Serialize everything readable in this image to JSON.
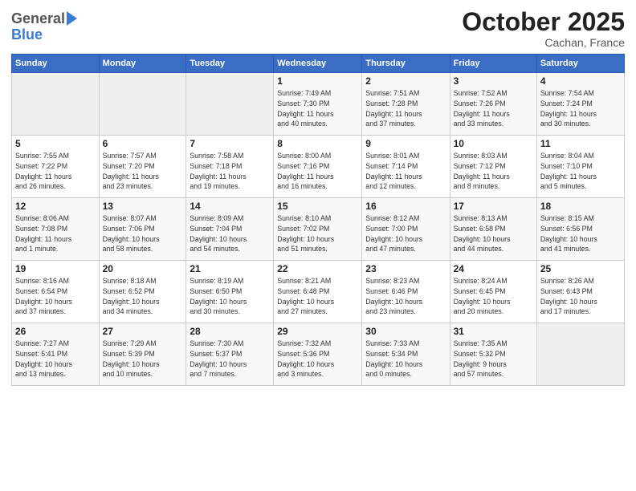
{
  "logo": {
    "general": "General",
    "blue": "Blue"
  },
  "header": {
    "month": "October 2025",
    "location": "Cachan, France"
  },
  "weekdays": [
    "Sunday",
    "Monday",
    "Tuesday",
    "Wednesday",
    "Thursday",
    "Friday",
    "Saturday"
  ],
  "weeks": [
    [
      {
        "day": "",
        "info": ""
      },
      {
        "day": "",
        "info": ""
      },
      {
        "day": "",
        "info": ""
      },
      {
        "day": "1",
        "info": "Sunrise: 7:49 AM\nSunset: 7:30 PM\nDaylight: 11 hours\nand 40 minutes."
      },
      {
        "day": "2",
        "info": "Sunrise: 7:51 AM\nSunset: 7:28 PM\nDaylight: 11 hours\nand 37 minutes."
      },
      {
        "day": "3",
        "info": "Sunrise: 7:52 AM\nSunset: 7:26 PM\nDaylight: 11 hours\nand 33 minutes."
      },
      {
        "day": "4",
        "info": "Sunrise: 7:54 AM\nSunset: 7:24 PM\nDaylight: 11 hours\nand 30 minutes."
      }
    ],
    [
      {
        "day": "5",
        "info": "Sunrise: 7:55 AM\nSunset: 7:22 PM\nDaylight: 11 hours\nand 26 minutes."
      },
      {
        "day": "6",
        "info": "Sunrise: 7:57 AM\nSunset: 7:20 PM\nDaylight: 11 hours\nand 23 minutes."
      },
      {
        "day": "7",
        "info": "Sunrise: 7:58 AM\nSunset: 7:18 PM\nDaylight: 11 hours\nand 19 minutes."
      },
      {
        "day": "8",
        "info": "Sunrise: 8:00 AM\nSunset: 7:16 PM\nDaylight: 11 hours\nand 16 minutes."
      },
      {
        "day": "9",
        "info": "Sunrise: 8:01 AM\nSunset: 7:14 PM\nDaylight: 11 hours\nand 12 minutes."
      },
      {
        "day": "10",
        "info": "Sunrise: 8:03 AM\nSunset: 7:12 PM\nDaylight: 11 hours\nand 8 minutes."
      },
      {
        "day": "11",
        "info": "Sunrise: 8:04 AM\nSunset: 7:10 PM\nDaylight: 11 hours\nand 5 minutes."
      }
    ],
    [
      {
        "day": "12",
        "info": "Sunrise: 8:06 AM\nSunset: 7:08 PM\nDaylight: 11 hours\nand 1 minute."
      },
      {
        "day": "13",
        "info": "Sunrise: 8:07 AM\nSunset: 7:06 PM\nDaylight: 10 hours\nand 58 minutes."
      },
      {
        "day": "14",
        "info": "Sunrise: 8:09 AM\nSunset: 7:04 PM\nDaylight: 10 hours\nand 54 minutes."
      },
      {
        "day": "15",
        "info": "Sunrise: 8:10 AM\nSunset: 7:02 PM\nDaylight: 10 hours\nand 51 minutes."
      },
      {
        "day": "16",
        "info": "Sunrise: 8:12 AM\nSunset: 7:00 PM\nDaylight: 10 hours\nand 47 minutes."
      },
      {
        "day": "17",
        "info": "Sunrise: 8:13 AM\nSunset: 6:58 PM\nDaylight: 10 hours\nand 44 minutes."
      },
      {
        "day": "18",
        "info": "Sunrise: 8:15 AM\nSunset: 6:56 PM\nDaylight: 10 hours\nand 41 minutes."
      }
    ],
    [
      {
        "day": "19",
        "info": "Sunrise: 8:16 AM\nSunset: 6:54 PM\nDaylight: 10 hours\nand 37 minutes."
      },
      {
        "day": "20",
        "info": "Sunrise: 8:18 AM\nSunset: 6:52 PM\nDaylight: 10 hours\nand 34 minutes."
      },
      {
        "day": "21",
        "info": "Sunrise: 8:19 AM\nSunset: 6:50 PM\nDaylight: 10 hours\nand 30 minutes."
      },
      {
        "day": "22",
        "info": "Sunrise: 8:21 AM\nSunset: 6:48 PM\nDaylight: 10 hours\nand 27 minutes."
      },
      {
        "day": "23",
        "info": "Sunrise: 8:23 AM\nSunset: 6:46 PM\nDaylight: 10 hours\nand 23 minutes."
      },
      {
        "day": "24",
        "info": "Sunrise: 8:24 AM\nSunset: 6:45 PM\nDaylight: 10 hours\nand 20 minutes."
      },
      {
        "day": "25",
        "info": "Sunrise: 8:26 AM\nSunset: 6:43 PM\nDaylight: 10 hours\nand 17 minutes."
      }
    ],
    [
      {
        "day": "26",
        "info": "Sunrise: 7:27 AM\nSunset: 5:41 PM\nDaylight: 10 hours\nand 13 minutes."
      },
      {
        "day": "27",
        "info": "Sunrise: 7:29 AM\nSunset: 5:39 PM\nDaylight: 10 hours\nand 10 minutes."
      },
      {
        "day": "28",
        "info": "Sunrise: 7:30 AM\nSunset: 5:37 PM\nDaylight: 10 hours\nand 7 minutes."
      },
      {
        "day": "29",
        "info": "Sunrise: 7:32 AM\nSunset: 5:36 PM\nDaylight: 10 hours\nand 3 minutes."
      },
      {
        "day": "30",
        "info": "Sunrise: 7:33 AM\nSunset: 5:34 PM\nDaylight: 10 hours\nand 0 minutes."
      },
      {
        "day": "31",
        "info": "Sunrise: 7:35 AM\nSunset: 5:32 PM\nDaylight: 9 hours\nand 57 minutes."
      },
      {
        "day": "",
        "info": ""
      }
    ]
  ]
}
